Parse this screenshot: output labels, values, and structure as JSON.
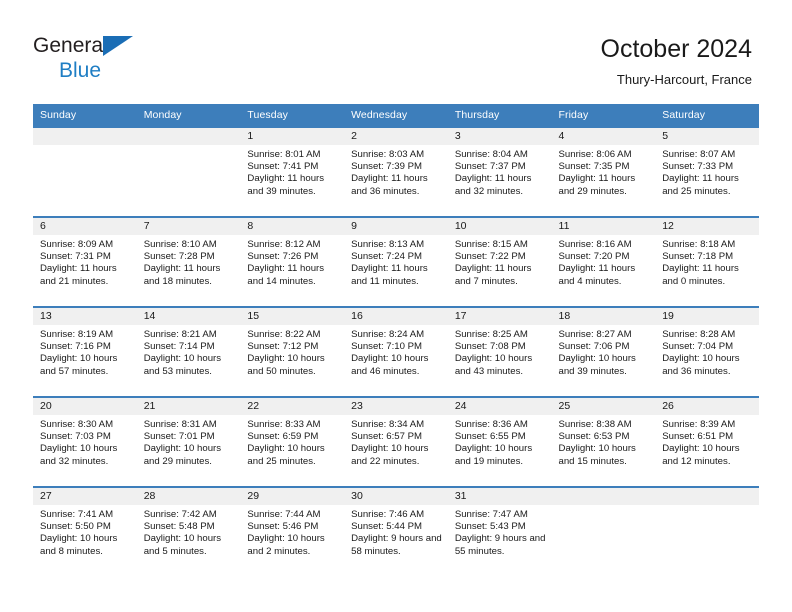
{
  "brand": {
    "line1": "General",
    "line2": "Blue",
    "triangle_icon": "triangle-icon",
    "color": "#1f7ec4"
  },
  "header": {
    "title": "October 2024",
    "subtitle": "Thury-Harcourt, France"
  },
  "theme": {
    "header_blue": "#3d7ebb",
    "band_gray": "#f0f0f0",
    "text": "#1a1a1a"
  },
  "weekdays": [
    "Sunday",
    "Monday",
    "Tuesday",
    "Wednesday",
    "Thursday",
    "Friday",
    "Saturday"
  ],
  "weeks": [
    [
      {
        "date": "",
        "empty": true
      },
      {
        "date": "",
        "empty": true
      },
      {
        "date": "1",
        "sunrise": "Sunrise: 8:01 AM",
        "sunset": "Sunset: 7:41 PM",
        "daylight": "Daylight: 11 hours and 39 minutes."
      },
      {
        "date": "2",
        "sunrise": "Sunrise: 8:03 AM",
        "sunset": "Sunset: 7:39 PM",
        "daylight": "Daylight: 11 hours and 36 minutes."
      },
      {
        "date": "3",
        "sunrise": "Sunrise: 8:04 AM",
        "sunset": "Sunset: 7:37 PM",
        "daylight": "Daylight: 11 hours and 32 minutes."
      },
      {
        "date": "4",
        "sunrise": "Sunrise: 8:06 AM",
        "sunset": "Sunset: 7:35 PM",
        "daylight": "Daylight: 11 hours and 29 minutes."
      },
      {
        "date": "5",
        "sunrise": "Sunrise: 8:07 AM",
        "sunset": "Sunset: 7:33 PM",
        "daylight": "Daylight: 11 hours and 25 minutes."
      }
    ],
    [
      {
        "date": "6",
        "sunrise": "Sunrise: 8:09 AM",
        "sunset": "Sunset: 7:31 PM",
        "daylight": "Daylight: 11 hours and 21 minutes."
      },
      {
        "date": "7",
        "sunrise": "Sunrise: 8:10 AM",
        "sunset": "Sunset: 7:28 PM",
        "daylight": "Daylight: 11 hours and 18 minutes."
      },
      {
        "date": "8",
        "sunrise": "Sunrise: 8:12 AM",
        "sunset": "Sunset: 7:26 PM",
        "daylight": "Daylight: 11 hours and 14 minutes."
      },
      {
        "date": "9",
        "sunrise": "Sunrise: 8:13 AM",
        "sunset": "Sunset: 7:24 PM",
        "daylight": "Daylight: 11 hours and 11 minutes."
      },
      {
        "date": "10",
        "sunrise": "Sunrise: 8:15 AM",
        "sunset": "Sunset: 7:22 PM",
        "daylight": "Daylight: 11 hours and 7 minutes."
      },
      {
        "date": "11",
        "sunrise": "Sunrise: 8:16 AM",
        "sunset": "Sunset: 7:20 PM",
        "daylight": "Daylight: 11 hours and 4 minutes."
      },
      {
        "date": "12",
        "sunrise": "Sunrise: 8:18 AM",
        "sunset": "Sunset: 7:18 PM",
        "daylight": "Daylight: 11 hours and 0 minutes."
      }
    ],
    [
      {
        "date": "13",
        "sunrise": "Sunrise: 8:19 AM",
        "sunset": "Sunset: 7:16 PM",
        "daylight": "Daylight: 10 hours and 57 minutes."
      },
      {
        "date": "14",
        "sunrise": "Sunrise: 8:21 AM",
        "sunset": "Sunset: 7:14 PM",
        "daylight": "Daylight: 10 hours and 53 minutes."
      },
      {
        "date": "15",
        "sunrise": "Sunrise: 8:22 AM",
        "sunset": "Sunset: 7:12 PM",
        "daylight": "Daylight: 10 hours and 50 minutes."
      },
      {
        "date": "16",
        "sunrise": "Sunrise: 8:24 AM",
        "sunset": "Sunset: 7:10 PM",
        "daylight": "Daylight: 10 hours and 46 minutes."
      },
      {
        "date": "17",
        "sunrise": "Sunrise: 8:25 AM",
        "sunset": "Sunset: 7:08 PM",
        "daylight": "Daylight: 10 hours and 43 minutes."
      },
      {
        "date": "18",
        "sunrise": "Sunrise: 8:27 AM",
        "sunset": "Sunset: 7:06 PM",
        "daylight": "Daylight: 10 hours and 39 minutes."
      },
      {
        "date": "19",
        "sunrise": "Sunrise: 8:28 AM",
        "sunset": "Sunset: 7:04 PM",
        "daylight": "Daylight: 10 hours and 36 minutes."
      }
    ],
    [
      {
        "date": "20",
        "sunrise": "Sunrise: 8:30 AM",
        "sunset": "Sunset: 7:03 PM",
        "daylight": "Daylight: 10 hours and 32 minutes."
      },
      {
        "date": "21",
        "sunrise": "Sunrise: 8:31 AM",
        "sunset": "Sunset: 7:01 PM",
        "daylight": "Daylight: 10 hours and 29 minutes."
      },
      {
        "date": "22",
        "sunrise": "Sunrise: 8:33 AM",
        "sunset": "Sunset: 6:59 PM",
        "daylight": "Daylight: 10 hours and 25 minutes."
      },
      {
        "date": "23",
        "sunrise": "Sunrise: 8:34 AM",
        "sunset": "Sunset: 6:57 PM",
        "daylight": "Daylight: 10 hours and 22 minutes."
      },
      {
        "date": "24",
        "sunrise": "Sunrise: 8:36 AM",
        "sunset": "Sunset: 6:55 PM",
        "daylight": "Daylight: 10 hours and 19 minutes."
      },
      {
        "date": "25",
        "sunrise": "Sunrise: 8:38 AM",
        "sunset": "Sunset: 6:53 PM",
        "daylight": "Daylight: 10 hours and 15 minutes."
      },
      {
        "date": "26",
        "sunrise": "Sunrise: 8:39 AM",
        "sunset": "Sunset: 6:51 PM",
        "daylight": "Daylight: 10 hours and 12 minutes."
      }
    ],
    [
      {
        "date": "27",
        "sunrise": "Sunrise: 7:41 AM",
        "sunset": "Sunset: 5:50 PM",
        "daylight": "Daylight: 10 hours and 8 minutes."
      },
      {
        "date": "28",
        "sunrise": "Sunrise: 7:42 AM",
        "sunset": "Sunset: 5:48 PM",
        "daylight": "Daylight: 10 hours and 5 minutes."
      },
      {
        "date": "29",
        "sunrise": "Sunrise: 7:44 AM",
        "sunset": "Sunset: 5:46 PM",
        "daylight": "Daylight: 10 hours and 2 minutes."
      },
      {
        "date": "30",
        "sunrise": "Sunrise: 7:46 AM",
        "sunset": "Sunset: 5:44 PM",
        "daylight": "Daylight: 9 hours and 58 minutes."
      },
      {
        "date": "31",
        "sunrise": "Sunrise: 7:47 AM",
        "sunset": "Sunset: 5:43 PM",
        "daylight": "Daylight: 9 hours and 55 minutes."
      },
      {
        "date": "",
        "empty": true
      },
      {
        "date": "",
        "empty": true
      }
    ]
  ]
}
